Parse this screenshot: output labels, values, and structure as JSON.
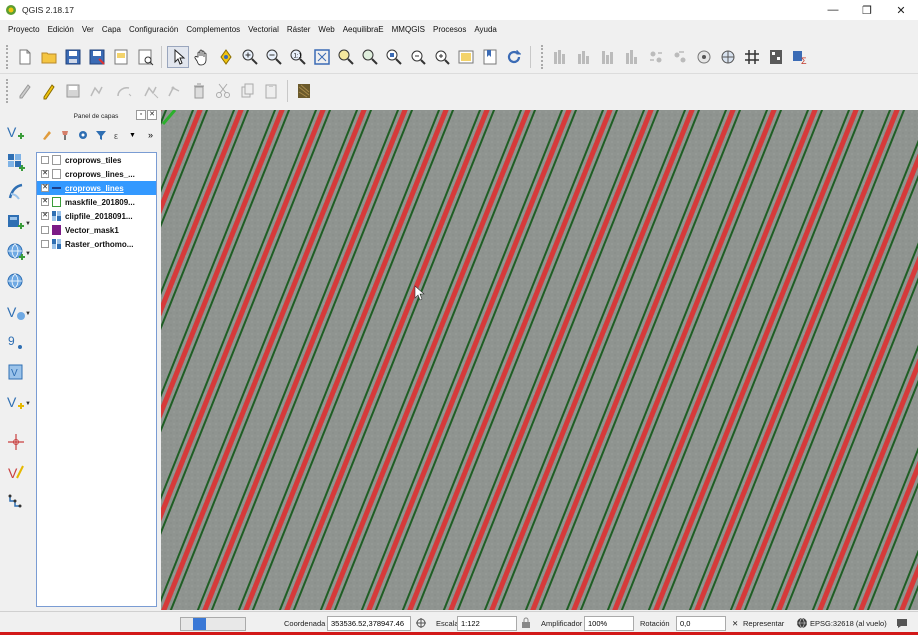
{
  "window": {
    "title": "QGIS 2.18.17"
  },
  "window_controls": {
    "minimize": "—",
    "maximize": "❐",
    "close": "✕"
  },
  "menu": [
    "Proyecto",
    "Edición",
    "Ver",
    "Capa",
    "Configuración",
    "Complementos",
    "Vectorial",
    "Ráster",
    "Web",
    "AequilibraE",
    "MMQGIS",
    "Procesos",
    "Ayuda"
  ],
  "layers_panel": {
    "title": "Panel de capas",
    "layers": [
      {
        "name": "croprows_tiles",
        "checked": false,
        "symbol": "polygon-white",
        "selected": false
      },
      {
        "name": "croprows_lines_...",
        "checked": true,
        "symbol": "polygon-white",
        "selected": false
      },
      {
        "name": "croprows_lines",
        "checked": true,
        "symbol": "line-blue",
        "selected": true
      },
      {
        "name": "maskfile_201809...",
        "checked": true,
        "symbol": "polygon-white-green",
        "selected": false
      },
      {
        "name": "clipfile_2018091...",
        "checked": true,
        "symbol": "raster",
        "selected": false
      },
      {
        "name": "Vector_mask1",
        "checked": false,
        "symbol": "polygon-purple",
        "selected": false
      },
      {
        "name": "Raster_orthomo...",
        "checked": false,
        "symbol": "raster",
        "selected": false
      }
    ]
  },
  "status": {
    "coordinate_label": "Coordenada",
    "coordinate_value": "353536.52,378947.46",
    "scale_label": "Escala",
    "scale_value": "1:122",
    "magnifier_label": "Amplificador",
    "magnifier_value": "100%",
    "rotation_label": "Rotación",
    "rotation_value": "0,0",
    "render_label": "Representar",
    "crs_label": "EPSG:32618 (al vuelo)",
    "progress_fraction": 0.33
  },
  "colors": {
    "row_red": "#d63a3a",
    "row_green": "#1f5e24",
    "soil": "#8f9490",
    "selection": "#3399ff"
  }
}
